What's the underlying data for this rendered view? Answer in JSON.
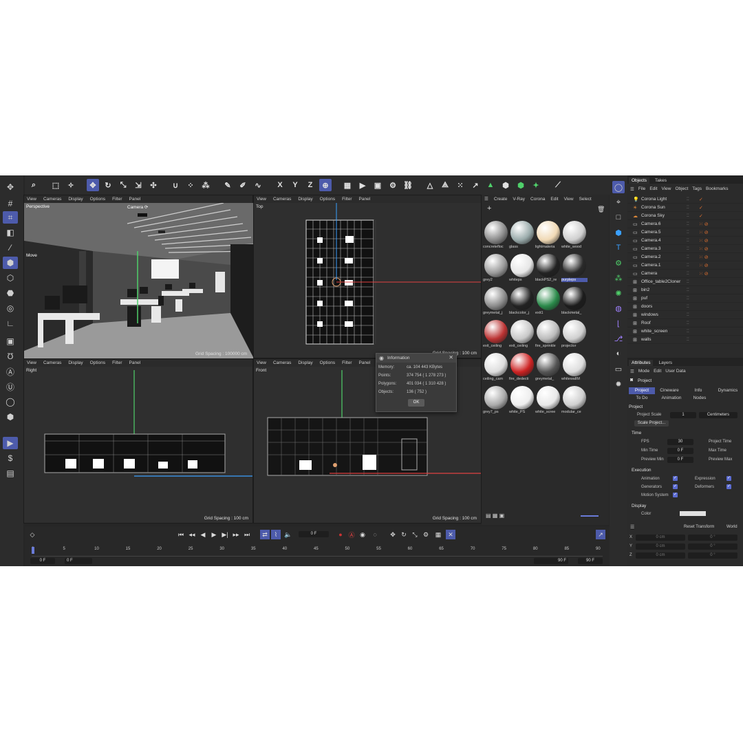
{
  "toolbar": {
    "axes": [
      "X",
      "Y",
      "Z"
    ]
  },
  "viewports": {
    "perspective": {
      "menu": [
        "View",
        "Cameras",
        "Display",
        "Options",
        "Filter",
        "Panel"
      ],
      "name": "Perspective",
      "camera": "Camera ⟳",
      "tool": "Move",
      "grid": "Grid Spacing : 100000 cm"
    },
    "top": {
      "menu": [
        "View",
        "Cameras",
        "Display",
        "Options",
        "Filter",
        "Panel"
      ],
      "name": "Top",
      "grid": "Grid Spacing : 100 cm"
    },
    "right": {
      "menu": [
        "View",
        "Cameras",
        "Display",
        "Options",
        "Filter",
        "Panel"
      ],
      "name": "Right",
      "grid": "Grid Spacing : 100 cm"
    },
    "front": {
      "menu": [
        "View",
        "Cameras",
        "Display",
        "Options",
        "Filter",
        "Panel"
      ],
      "name": "Front",
      "grid": "Grid Spacing : 100 cm"
    }
  },
  "info_dialog": {
    "title": "Information",
    "rows": [
      {
        "label": "Memory:",
        "value": "ca. 104 443 KBytes"
      },
      {
        "label": "Points:",
        "value": "374 754  ( 1 278 273 )"
      },
      {
        "label": "Polygons:",
        "value": "401 034  ( 1 310 428 )"
      },
      {
        "label": "Objects:",
        "value": "136  ( 752 )"
      }
    ],
    "ok": "OK"
  },
  "materials": {
    "menu": [
      "Create",
      "V-Ray",
      "Corona",
      "Edit",
      "View",
      "Select"
    ],
    "items": [
      {
        "label": "concretefloc",
        "color": "#8a8a8a"
      },
      {
        "label": "glass",
        "color": "#9aa"
      },
      {
        "label": "lightmateria",
        "color": "#f0d9b5"
      },
      {
        "label": "white_wood",
        "color": "#cfcfcf"
      },
      {
        "label": "grey2",
        "color": "#9a9a9a"
      },
      {
        "label": "whiteps",
        "color": "#e6e6e6"
      },
      {
        "label": "blackPS2_re",
        "color": "#222"
      },
      {
        "label": "purpleps",
        "color": "#2a2a2a",
        "selected": true
      },
      {
        "label": "greymetal_j",
        "color": "#8c8c8c"
      },
      {
        "label": "blackcolor_j",
        "color": "#222"
      },
      {
        "label": "exit1",
        "color": "#2a8a4a"
      },
      {
        "label": "blackmetal_",
        "color": "#1c1c1c"
      },
      {
        "label": "exit_ceiling",
        "color": "#b33"
      },
      {
        "label": "exit_ceiling",
        "color": "#c8c8c8"
      },
      {
        "label": "fire_sprinkle",
        "color": "#bbb"
      },
      {
        "label": "projector",
        "color": "#cfcfcf"
      },
      {
        "label": "ceiling_cam",
        "color": "#ddd"
      },
      {
        "label": "fire_dedecti",
        "color": "#c22"
      },
      {
        "label": "greymetal_",
        "color": "#555"
      },
      {
        "label": "whitewallM",
        "color": "#ddd"
      },
      {
        "label": "grey7_ps",
        "color": "#aaa"
      },
      {
        "label": "white_PS",
        "color": "#eee"
      },
      {
        "label": "white_scree",
        "color": "#e8e8e8"
      },
      {
        "label": "modular_ce",
        "color": "#cfcfcf"
      }
    ]
  },
  "objects": {
    "tabs": [
      "Objects",
      "Takes"
    ],
    "menu": [
      "File",
      "Edit",
      "View",
      "Object",
      "Tags",
      "Bookmarks"
    ],
    "rows": [
      {
        "name": "Corona Light",
        "icon": "light-icon"
      },
      {
        "name": "Corona Sun",
        "icon": "sun-icon"
      },
      {
        "name": "Corona Sky",
        "icon": "sky-icon"
      },
      {
        "name": "Camera.6",
        "icon": "camera-icon"
      },
      {
        "name": "Camera.5",
        "icon": "camera-icon"
      },
      {
        "name": "Camera.4",
        "icon": "camera-icon"
      },
      {
        "name": "Camera.3",
        "icon": "camera-icon"
      },
      {
        "name": "Camera.2",
        "icon": "camera-icon"
      },
      {
        "name": "Camera.1",
        "icon": "camera-icon"
      },
      {
        "name": "Camera",
        "icon": "camera-icon"
      },
      {
        "name": "Office_table2Cloner",
        "icon": "null-icon"
      },
      {
        "name": "bin2",
        "icon": "null-icon"
      },
      {
        "name": "puf",
        "icon": "null-icon"
      },
      {
        "name": "doors",
        "icon": "null-icon"
      },
      {
        "name": "windows",
        "icon": "null-icon"
      },
      {
        "name": "Roof",
        "icon": "null-icon"
      },
      {
        "name": "white_screen",
        "icon": "null-icon"
      },
      {
        "name": "walls",
        "icon": "null-icon"
      }
    ]
  },
  "attributes": {
    "tabs": [
      "Attributes",
      "Layers"
    ],
    "menu": [
      "Mode",
      "Edit",
      "User Data"
    ],
    "header": "Project",
    "ptabs": [
      "Project",
      "Cineware",
      "Info",
      "Dynamics"
    ],
    "ptabs2": [
      "To Do",
      "Animation",
      "Nodes"
    ],
    "section": "Project",
    "scale_label": "Project Scale",
    "scale_value": "1",
    "scale_unit": "Centimeters",
    "scale_button": "Scale Project...",
    "time": "Time",
    "fps_label": "FPS",
    "fps": "30",
    "project_time": "Project Time",
    "min_time_label": "Min Time",
    "min_time": "0 F",
    "max_time": "Max Time",
    "preview_min_label": "Preview Min",
    "preview_min": "0 F",
    "preview_max": "Preview Max",
    "execution": "Execution",
    "animation": "Animation",
    "expression": "Expression",
    "generators": "Generators",
    "deformers": "Deformers",
    "motion_system": "Motion System",
    "display": "Display",
    "color": "Color"
  },
  "coords": {
    "reset": "Reset Transform",
    "world": "World",
    "rows": [
      {
        "axis": "X",
        "val": "0 cm",
        "rot": "0 °"
      },
      {
        "axis": "Y",
        "val": "0 cm",
        "rot": "0 °"
      },
      {
        "axis": "Z",
        "val": "0 cm",
        "rot": "0 °"
      }
    ]
  },
  "timeline": {
    "frame": "0 F",
    "ticks": [
      "0",
      "5",
      "10",
      "15",
      "20",
      "25",
      "30",
      "35",
      "40",
      "45",
      "50",
      "55",
      "60",
      "65",
      "70",
      "75",
      "80",
      "85",
      "90"
    ],
    "start": "0 F",
    "start2": "0 F",
    "end": "90 F",
    "end2": "90 F"
  }
}
